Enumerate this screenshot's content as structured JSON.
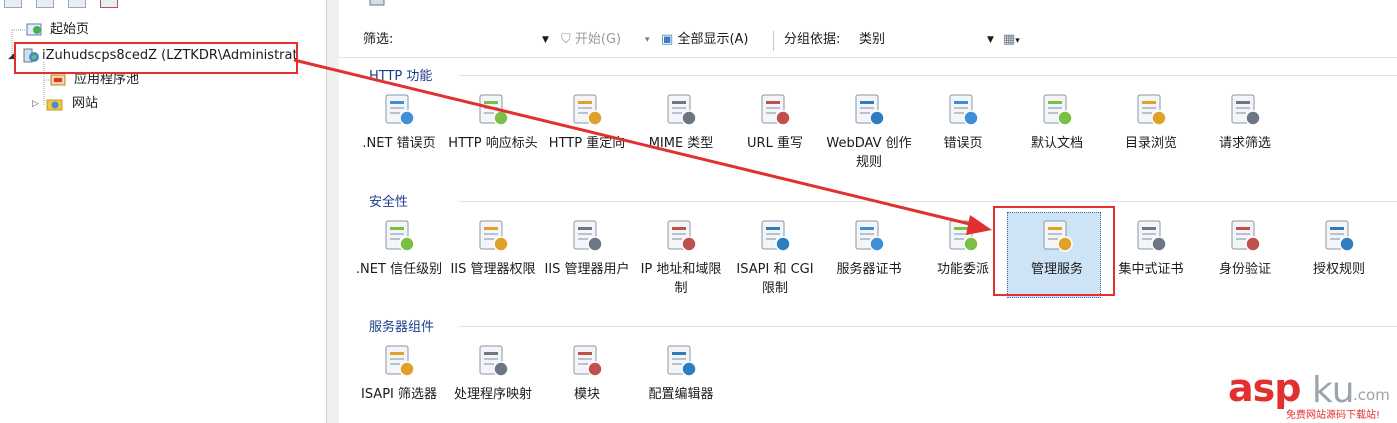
{
  "tree": {
    "items": [
      {
        "label": "起始页"
      },
      {
        "label": "iZuhudscps8cedZ (LZTKDR\\Administrat"
      },
      {
        "label": "应用程序池"
      },
      {
        "label": "网站"
      }
    ]
  },
  "filter_bar": {
    "filter_label": "筛选:",
    "start_label": "开始(G)",
    "show_all_label": "全部显示(A)",
    "group_by_label": "分组依据:",
    "group_by_value": "类别"
  },
  "groups": [
    {
      "title": "HTTP 功能",
      "features": [
        {
          "label": ".NET 错误页",
          "icon": "error-page-404-icon"
        },
        {
          "label": "HTTP 响应标头",
          "icon": "http-response-headers-icon"
        },
        {
          "label": "HTTP 重定向",
          "icon": "http-redirect-icon"
        },
        {
          "label": "MIME 类型",
          "icon": "mime-types-icon"
        },
        {
          "label": "URL 重写",
          "icon": "url-rewrite-icon"
        },
        {
          "label": "WebDAV 创作规则",
          "icon": "webdav-icon"
        },
        {
          "label": "错误页",
          "icon": "error-pages-icon"
        },
        {
          "label": "默认文档",
          "icon": "default-document-icon"
        },
        {
          "label": "目录浏览",
          "icon": "directory-browsing-icon"
        },
        {
          "label": "请求筛选",
          "icon": "request-filtering-icon"
        }
      ]
    },
    {
      "title": "安全性",
      "features": [
        {
          "label": ".NET 信任级别",
          "icon": "trust-level-icon"
        },
        {
          "label": "IIS 管理器权限",
          "icon": "iis-manager-permissions-icon"
        },
        {
          "label": "IIS 管理器用户",
          "icon": "iis-manager-users-icon"
        },
        {
          "label": "IP 地址和域限制",
          "icon": "ip-restrictions-icon"
        },
        {
          "label": "ISAPI 和 CGI 限制",
          "icon": "isapi-cgi-icon"
        },
        {
          "label": "服务器证书",
          "icon": "server-certificates-icon"
        },
        {
          "label": "功能委派",
          "icon": "feature-delegation-icon"
        },
        {
          "label": "管理服务",
          "icon": "management-service-icon"
        },
        {
          "label": "集中式证书",
          "icon": "centralized-certificates-icon"
        },
        {
          "label": "身份验证",
          "icon": "authentication-icon"
        },
        {
          "label": "授权规则",
          "icon": "authorization-rules-icon"
        }
      ]
    },
    {
      "title": "服务器组件",
      "features": [
        {
          "label": "ISAPI 筛选器",
          "icon": "isapi-filters-icon"
        },
        {
          "label": "处理程序映射",
          "icon": "handler-mappings-icon"
        },
        {
          "label": "模块",
          "icon": "modules-icon"
        },
        {
          "label": "配置编辑器",
          "icon": "configuration-editor-icon"
        }
      ]
    }
  ],
  "watermark": {
    "brand_asp": "asp",
    "brand_ku": "ku",
    "brand_com": ".com",
    "tagline": "免费网站源码下载站!"
  },
  "colors": {
    "highlight_red": "#e2302f",
    "group_header_blue": "#1e3d8f",
    "selection_blue": "#cfe3f7"
  }
}
